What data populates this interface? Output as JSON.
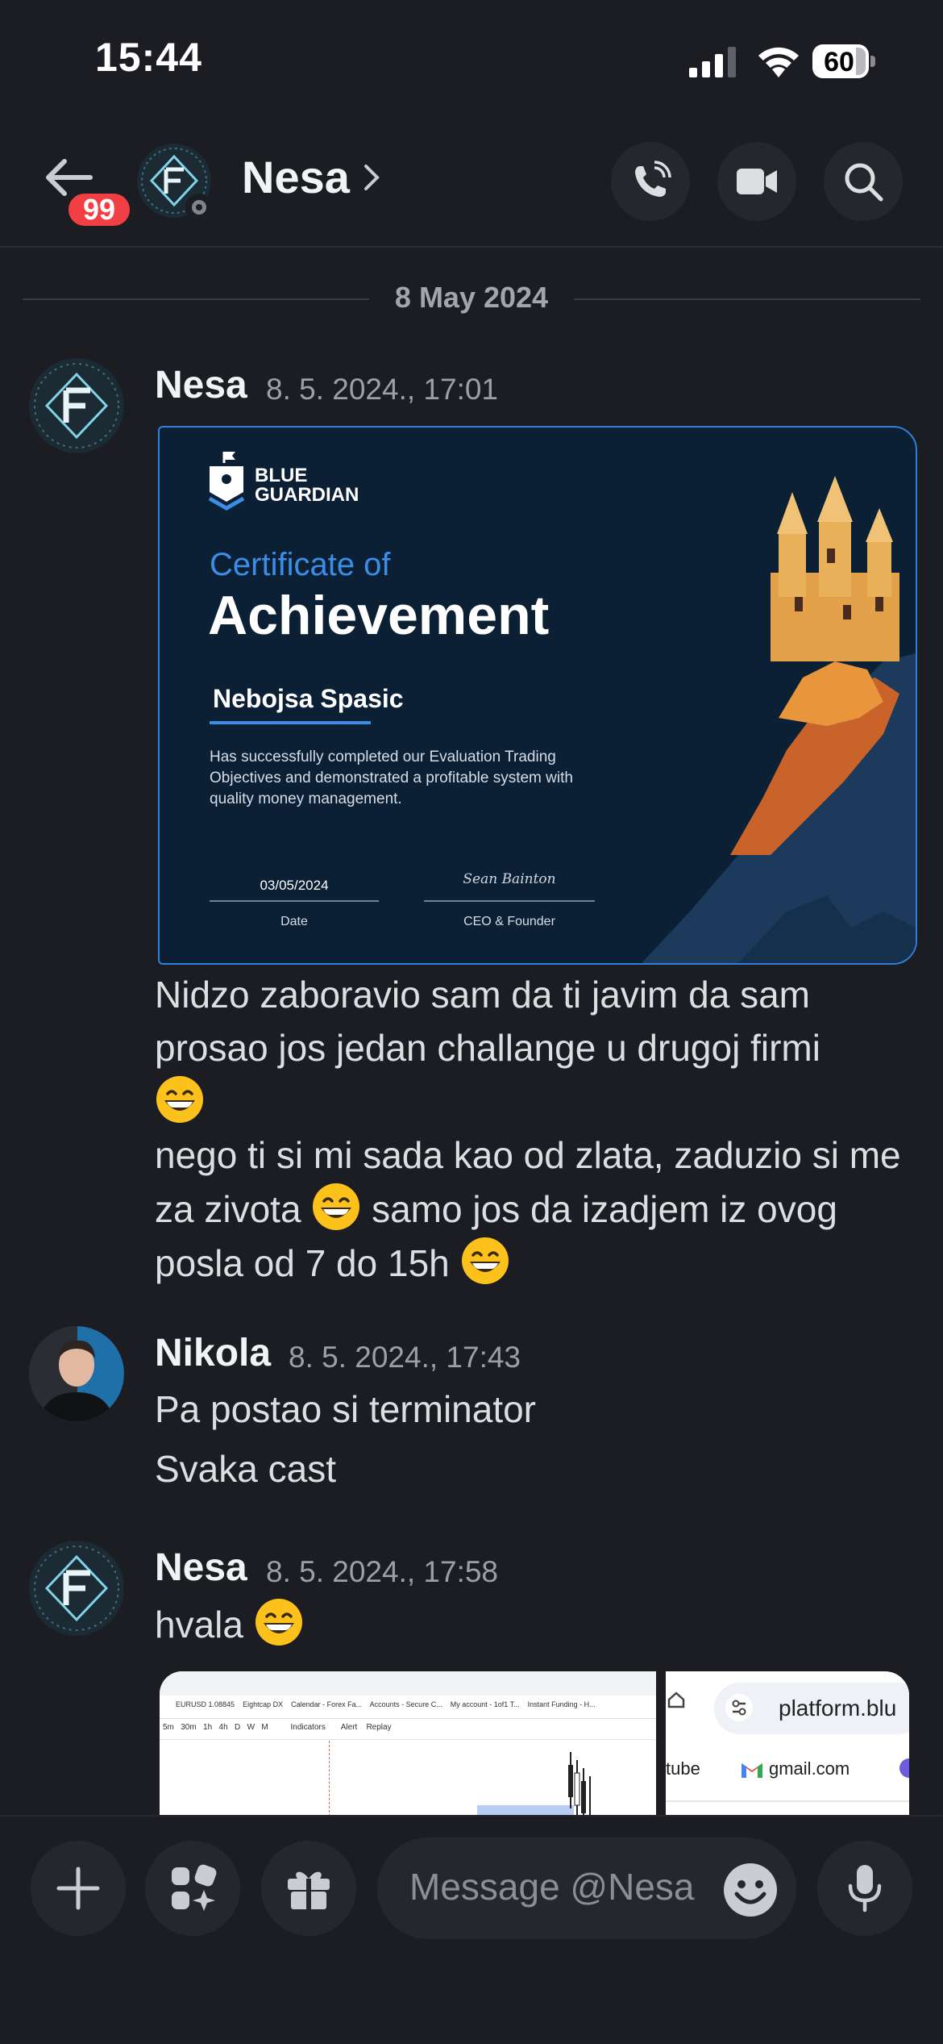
{
  "status_bar": {
    "time": "15:44",
    "battery": "60"
  },
  "header": {
    "unread_badge": "99",
    "title": "Nesa"
  },
  "date_divider": "8 May 2024",
  "messages": [
    {
      "author": "Nesa",
      "timestamp": "8. 5. 2024., 17:01",
      "certificate": {
        "brand_line1": "BLUE",
        "brand_line2": "GUARDIAN",
        "heading_small": "Certificate of",
        "heading_large": "Achievement",
        "name": "Nebojsa Spasic",
        "body": "Has successfully completed our Evaluation Trading Objectives and demonstrated a profitable system with quality money management.",
        "date_value": "03/05/2024",
        "date_label": "Date",
        "signature": "Sean Bainton",
        "signature_label": "CEO & Founder"
      },
      "lines": [
        "Nidzo zaboravio sam da ti javim da sam prosao jos jedan challange u drugoj firmi",
        "nego ti si mi sada kao od zlata, zaduzio si me za zivota",
        "samo jos da izadjem iz ovog posla od 7 do 15h"
      ]
    },
    {
      "author": "Nikola",
      "timestamp": "8. 5. 2024., 17:43",
      "lines": [
        "Pa postao si terminator",
        "Svaka cast"
      ]
    },
    {
      "author": "Nesa",
      "timestamp": "8. 5. 2024., 17:58",
      "lines": [
        "hvala"
      ],
      "attachments": [
        {
          "toolbar": [
            "5m",
            "30m",
            "1h",
            "4h",
            "D",
            "W",
            "M",
            "Indicators",
            "Alert",
            "Replay"
          ],
          "tabs": [
            "EURUSD 1.08845",
            "Eightcap DX",
            "Calendar - Forex Fa...",
            "Accounts - Secure C...",
            "My account - 1of1 T...",
            "Instant Funding - H..."
          ]
        },
        {
          "address": "platform.blu",
          "shortcuts": [
            "tube",
            "gmail.com"
          ]
        }
      ]
    }
  ],
  "composer": {
    "placeholder": "Message @Nesa"
  },
  "colors": {
    "background": "#1c1d22",
    "badge": "#f23f43",
    "certificate_bg": "#0c2035",
    "certificate_accent": "#3b8de6",
    "castle": "#e3a24a"
  }
}
